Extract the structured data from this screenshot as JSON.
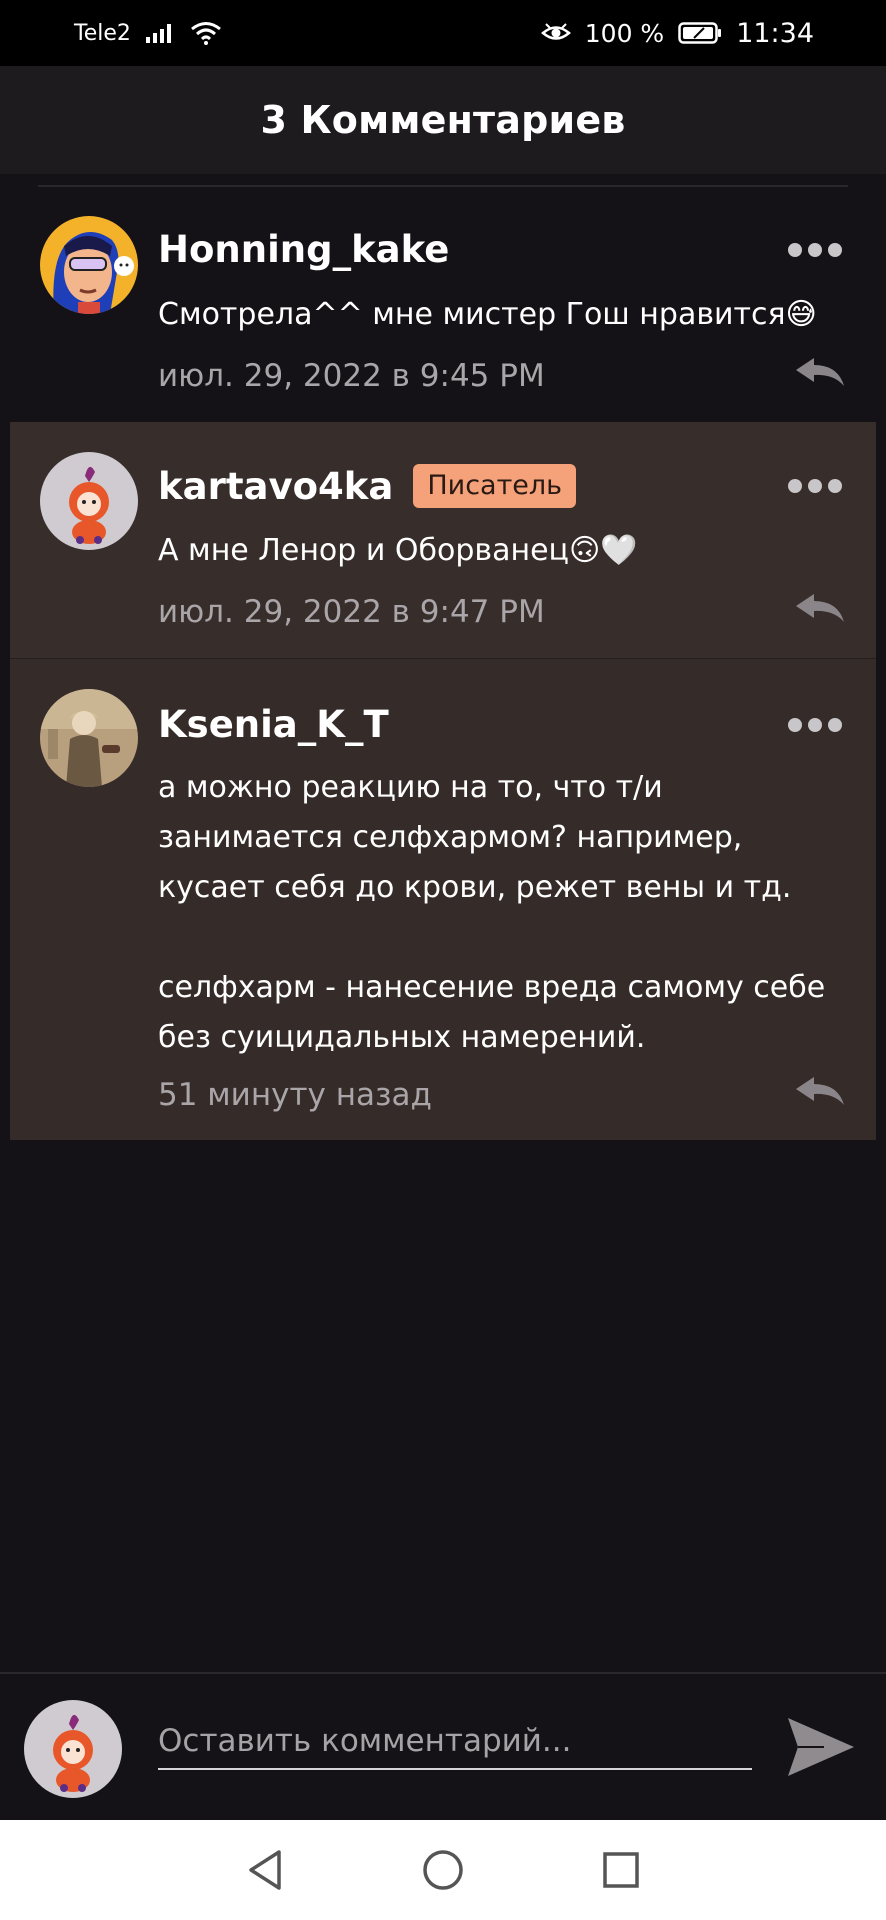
{
  "status_bar": {
    "carrier": "Tele2",
    "battery": "100 %",
    "time": "11:34"
  },
  "header": {
    "title": "3 Комментариев"
  },
  "comments": [
    {
      "username": "Honning_kake",
      "badge": "",
      "text": "Смотрела^^ мне мистер Гош нравится😅",
      "timestamp": "июл. 29, 2022 в 9:45 PM"
    },
    {
      "username": "kartavo4ka",
      "badge": "Писатель",
      "text": "А мне Ленор и Оборванец🙃🤍",
      "timestamp": "июл. 29, 2022 в 9:47 PM"
    },
    {
      "username": "Ksenia_K_T",
      "badge": "",
      "text": "а можно реакцию на то, что т/и\nзанимается селфхармом? например,\nкусает себя до крови, режет вены и тд.\n\nселфхарм - нанесение вреда самому себе\nбез суицидальных намерений.",
      "timestamp": "51 минуту назад"
    }
  ],
  "compose": {
    "placeholder": "Оставить комментарий..."
  },
  "colors": {
    "background": "#141216",
    "header": "#1d1b1e",
    "highlight_row": "#372d2a",
    "badge": "#f5a27a",
    "muted_text": "#a9a5a8"
  },
  "icons": [
    "signal-icon",
    "wifi-icon",
    "eye-icon",
    "battery-icon",
    "more-icon",
    "reply-icon",
    "send-icon",
    "nav-back-icon",
    "nav-home-icon",
    "nav-recents-icon"
  ]
}
